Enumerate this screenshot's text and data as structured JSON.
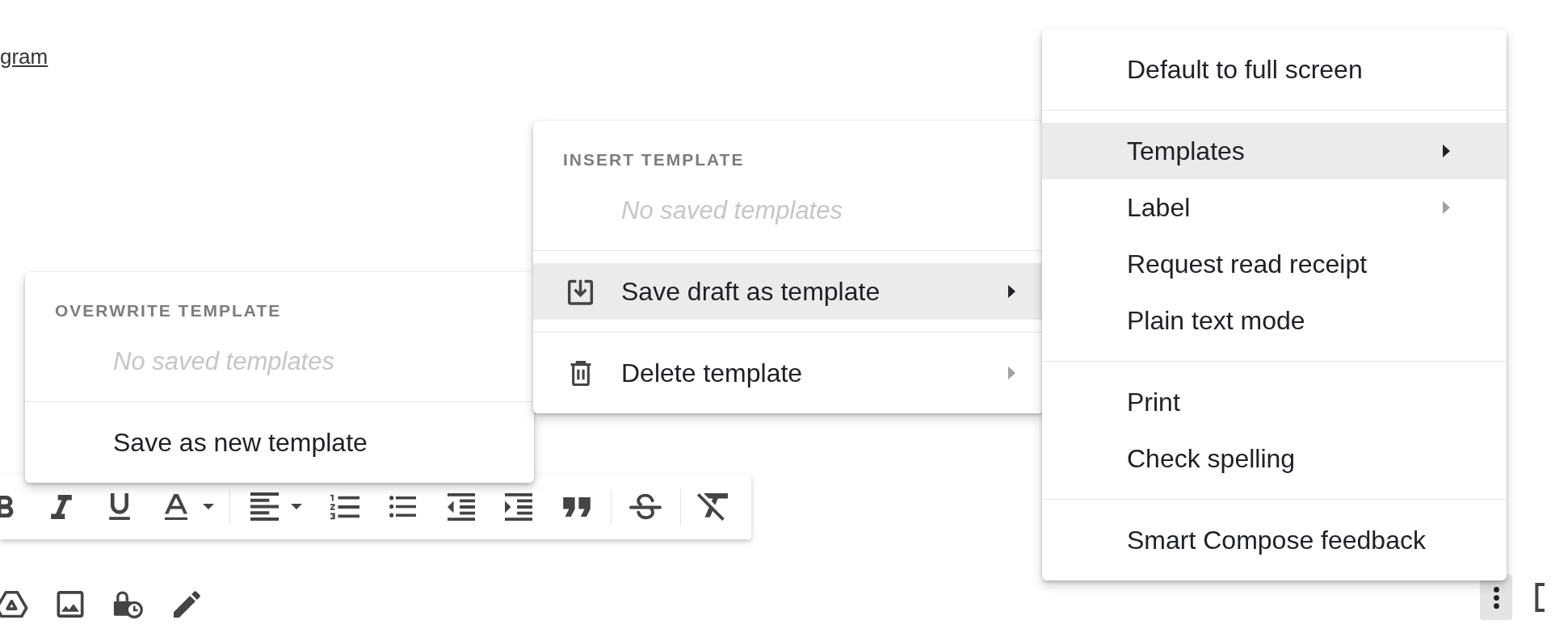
{
  "compose": {
    "link_text": "gram",
    "more_button": {
      "active": true
    }
  },
  "more_options_menu": {
    "sections": [
      {
        "items": [
          {
            "label": "Default to full screen",
            "selected": false,
            "submenu": false
          }
        ]
      },
      {
        "items": [
          {
            "label": "Templates",
            "selected": true,
            "submenu": true
          },
          {
            "label": "Label",
            "selected": false,
            "submenu": true
          },
          {
            "label": "Request read receipt",
            "selected": false,
            "submenu": false
          },
          {
            "label": "Plain text mode",
            "selected": false,
            "submenu": false
          }
        ]
      },
      {
        "items": [
          {
            "label": "Print",
            "selected": false,
            "submenu": false
          },
          {
            "label": "Check spelling",
            "selected": false,
            "submenu": false
          }
        ]
      },
      {
        "items": [
          {
            "label": "Smart Compose feedback",
            "selected": false,
            "submenu": false
          }
        ]
      }
    ]
  },
  "templates_menu": {
    "header": "INSERT TEMPLATE",
    "empty_note": "No saved templates",
    "sections": [
      {
        "items": [
          {
            "label": "Save draft as template",
            "selected": true,
            "submenu": true
          }
        ]
      },
      {
        "items": [
          {
            "label": "Delete template",
            "selected": false,
            "submenu": true
          }
        ]
      }
    ]
  },
  "save_draft_submenu": {
    "header": "OVERWRITE TEMPLATE",
    "empty_note": "No saved templates",
    "items": [
      {
        "label": "Save as new template",
        "selected": false
      }
    ]
  }
}
